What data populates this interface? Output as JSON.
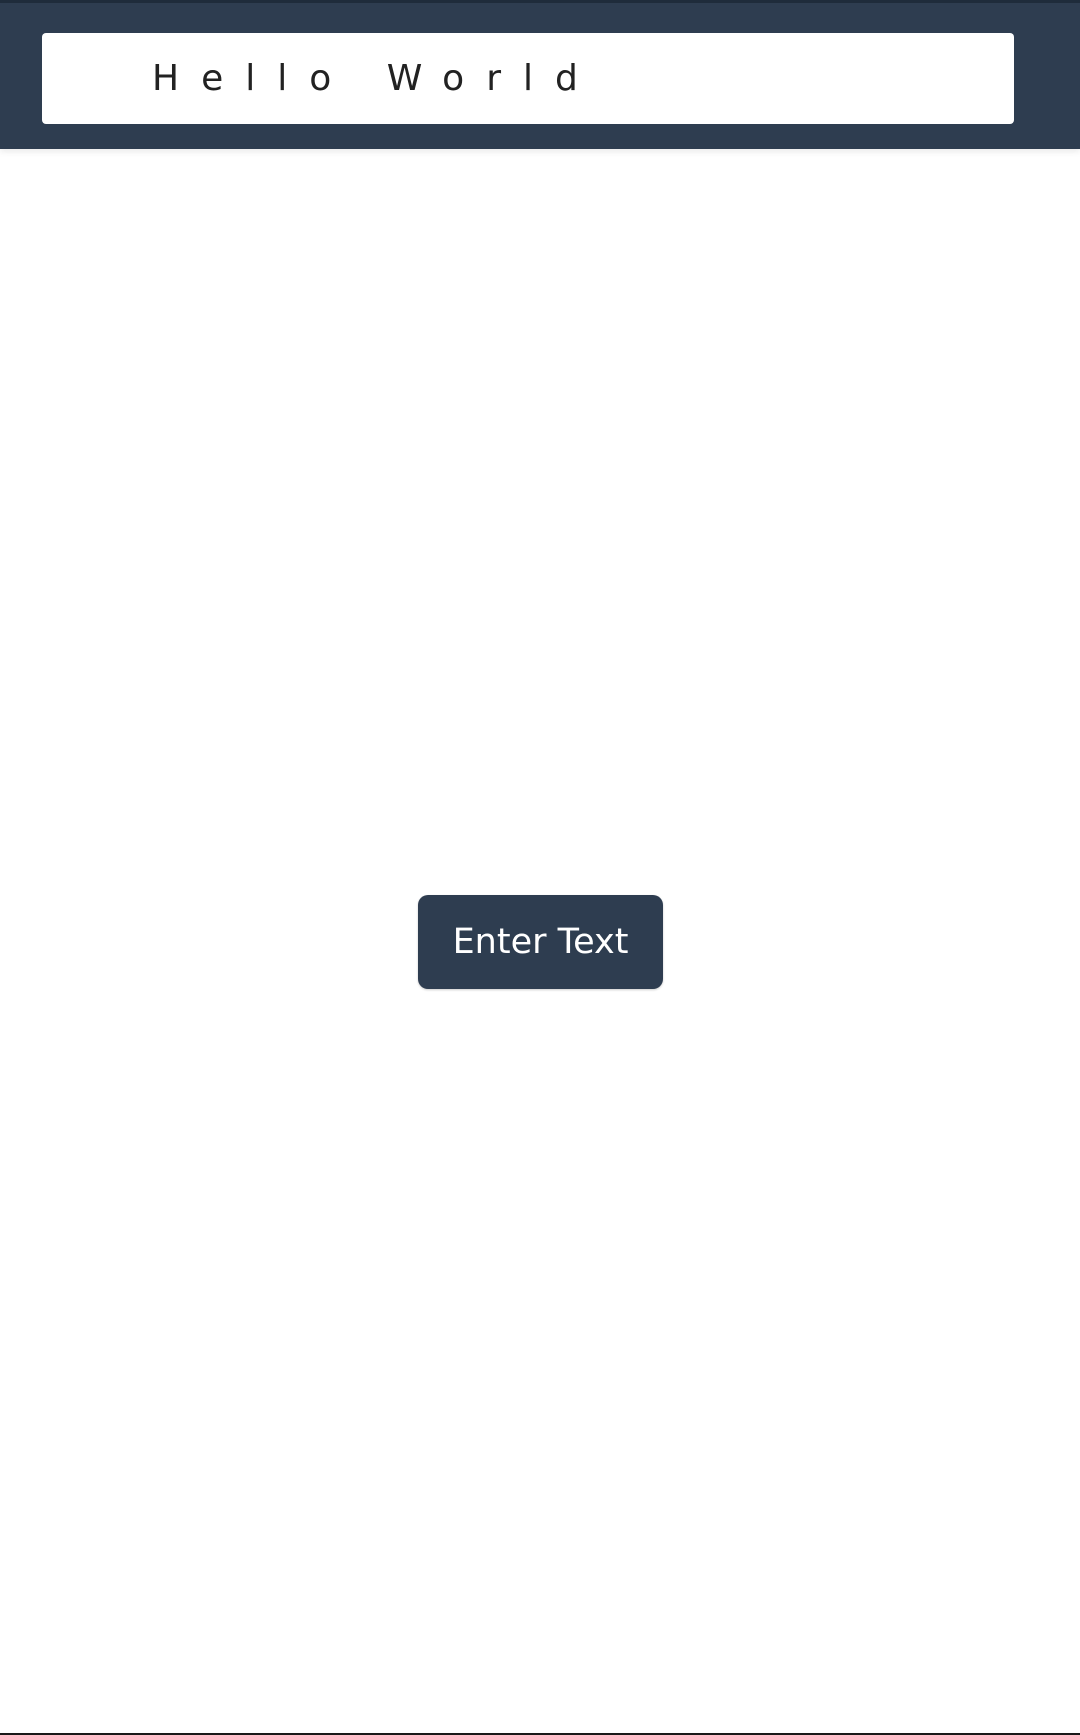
{
  "header": {
    "display_text": "Hello World"
  },
  "main": {
    "enter_button_label": "Enter Text"
  },
  "colors": {
    "primary": "#2e3d50",
    "background": "#ffffff",
    "text": "#222222"
  }
}
